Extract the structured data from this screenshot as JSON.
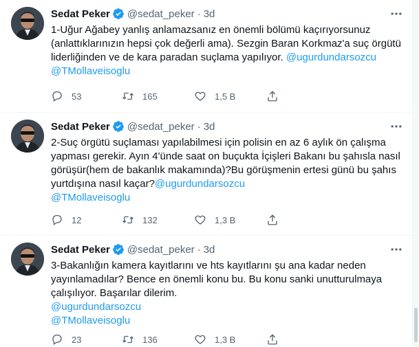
{
  "colors": {
    "link": "#1d9bf0",
    "secondary": "#536471",
    "verified": "#1d9bf0"
  },
  "tweets": [
    {
      "name": "Sedat Peker",
      "handle": "@sedat_peker",
      "sep": "·",
      "time": "3d",
      "lines": [
        {
          "text": "1-Uğur Ağabey yanlış anlamazsanız en önemli bölümü kaçırıyorsunuz"
        },
        {
          "text": "(anlattıklarınızın hepsi çok değerli ama). Sezgin Baran Korkmaz'a suç örgütü"
        },
        {
          "text": "liderliğinden ve de kara paradan suçlama yapılıyor. ",
          "mention": "@ugurdundarsozcu"
        },
        {
          "mention": "@TMollaveisoglu"
        }
      ],
      "replies": "53",
      "retweets": "165",
      "likes": "1,5 B"
    },
    {
      "name": "Sedat Peker",
      "handle": "@sedat_peker",
      "sep": "·",
      "time": "3d",
      "lines": [
        {
          "text": "2-Suç örgütü suçlaması yapılabilmesi için polisin en az 6 aylık ön çalışma"
        },
        {
          "text": "yapması gerekir. Ayın 4'ünde saat on buçukta İçişleri Bakanı bu şahısla nasıl"
        },
        {
          "text": "görüşür(hem de bakanlık makamında)?Bu görüşmenin ertesi günü bu şahıs"
        },
        {
          "text": "yurtdışına nasıl kaçar?",
          "mention": "@ugurdundarsozcu"
        },
        {
          "mention": "@TMollaveisoglu"
        }
      ],
      "replies": "12",
      "retweets": "132",
      "likes": "1,3 B"
    },
    {
      "name": "Sedat Peker",
      "handle": "@sedat_peker",
      "sep": "·",
      "time": "3d",
      "lines": [
        {
          "text": "3-Bakanlığın kamera kayıtlarını ve hts kayıtlarını şu ana kadar neden"
        },
        {
          "text": "yayınlamadılar? Bence en önemli konu bu. Bu konu sanki unutturulmaya"
        },
        {
          "text": "çalışılıyor. Başarılar dilerim."
        },
        {
          "mention": "@ugurdundarsozcu"
        },
        {
          "mention": "@TMollaveisoglu"
        }
      ],
      "replies": "23",
      "retweets": "136",
      "likes": "1,3 B"
    }
  ]
}
